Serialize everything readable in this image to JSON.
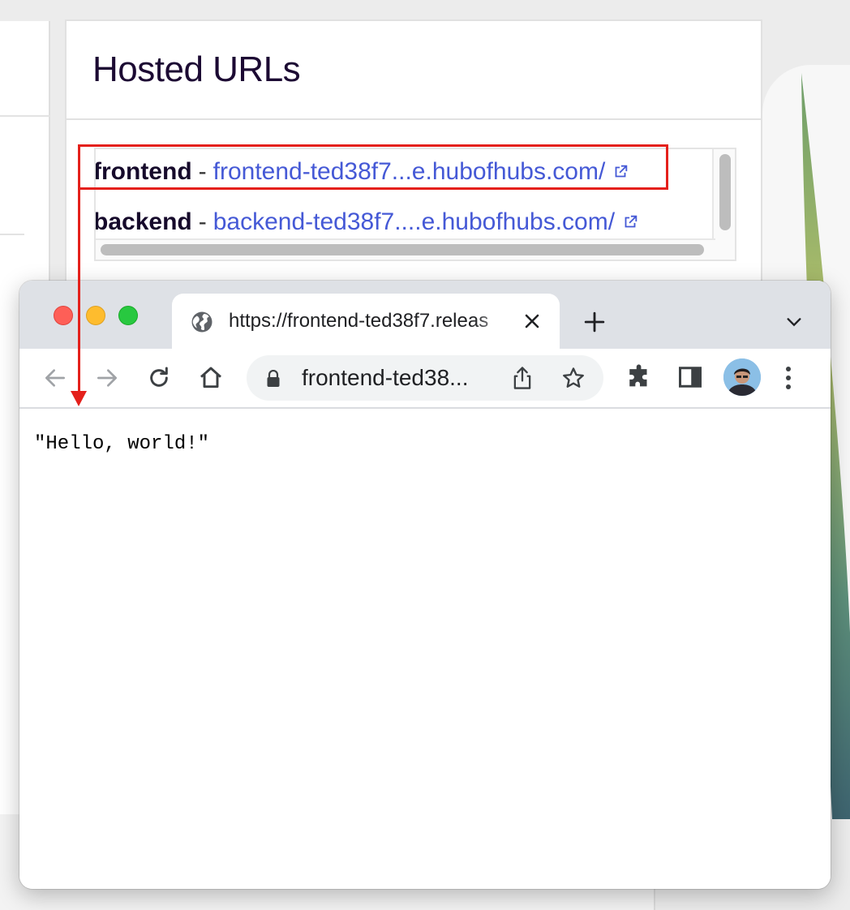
{
  "hosted_panel": {
    "title": "Hosted URLs",
    "urls": [
      {
        "service": "frontend",
        "separator": "-",
        "link": "frontend-ted38f7...e.hubofhubs.com/",
        "icon": "external-link-icon"
      },
      {
        "service": "backend",
        "separator": "-",
        "link": "backend-ted38f7....e.hubofhubs.com/",
        "icon": "external-link-icon"
      }
    ]
  },
  "browser": {
    "tab": {
      "title": "https://frontend-ted38f7.releas",
      "icon": "globe-icon"
    },
    "address_bar": {
      "text": "frontend-ted38..."
    },
    "page": {
      "content": "\"Hello, world!\""
    }
  },
  "colors": {
    "link": "#4559d6",
    "title": "#1c0a33",
    "annotation": "#e4201b",
    "tabstrip": "#dee1e6"
  }
}
